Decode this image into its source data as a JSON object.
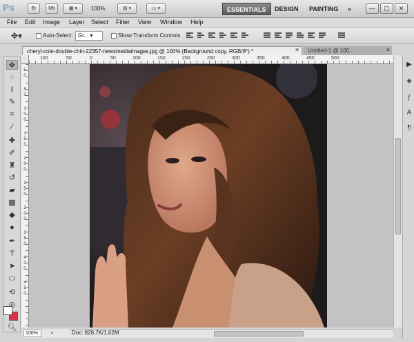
{
  "app": {
    "logo": "Ps",
    "buttons": [
      "Br",
      "Mb"
    ],
    "zoom": "100%",
    "workspaces": [
      "ESSENTIALS",
      "DESIGN",
      "PAINTING",
      "»"
    ]
  },
  "menu": [
    "File",
    "Edit",
    "Image",
    "Layer",
    "Select",
    "Filter",
    "View",
    "Window",
    "Help"
  ],
  "options": {
    "auto_select_label": "Auto-Select:",
    "auto_select_value": "Gr...",
    "show_transform_label": "Show Transform Controls"
  },
  "tabs": {
    "active": "cheryl-cole-double-chin-22357-newsmediaimages.jpg @ 100% (Background copy, RGB/8*) *",
    "inactive": "Untitled-1 @ 100..."
  },
  "ruler": {
    "top": [
      "100",
      "50",
      "0",
      "50",
      "100",
      "150",
      "200",
      "250",
      "300",
      "350",
      "400",
      "450",
      "500"
    ],
    "left": [
      "5",
      "0",
      "5",
      "0",
      "1",
      "0",
      "0",
      "1",
      "5",
      "0",
      "2",
      "0",
      "0",
      "2",
      "5",
      "0",
      "3",
      "0",
      "0",
      "3",
      "5",
      "0",
      "4",
      "0",
      "0",
      "4",
      "5",
      "0"
    ]
  },
  "status": {
    "zoom": "100%",
    "doc": "Doc: 828,7K/1,62M"
  },
  "colors": {
    "foreground": "#ffffff",
    "background": "#d9334f",
    "workspace_active_bg": "#6f6f6f"
  },
  "icons": {
    "tools": [
      "move-icon",
      "marquee-icon",
      "lasso-icon",
      "quick-select-icon",
      "crop-icon",
      "eyedropper-icon",
      "healing-icon",
      "brush-icon",
      "clone-stamp-icon",
      "history-brush-icon",
      "eraser-icon",
      "gradient-icon",
      "blur-icon",
      "dodge-icon",
      "pen-icon",
      "type-icon",
      "path-select-icon",
      "shape-icon",
      "3d-rotate-icon",
      "3d-orbit-icon",
      "hand-icon",
      "zoom-icon"
    ],
    "right_panel": [
      "play-icon",
      "layers-icon",
      "fx-icon",
      "character-icon",
      "paragraph-icon"
    ]
  }
}
